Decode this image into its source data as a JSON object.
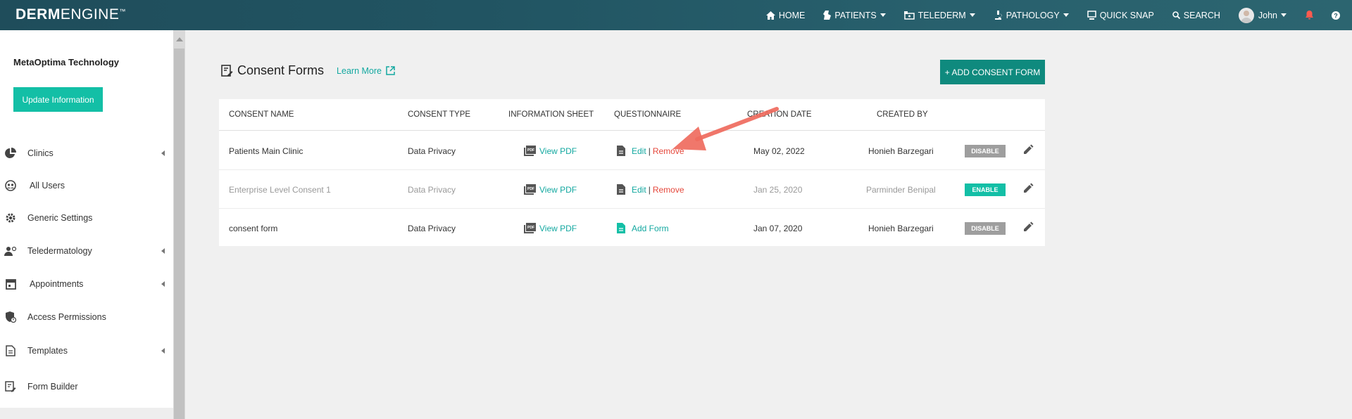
{
  "header": {
    "logo_bold": "DERM",
    "logo_light": "ENGINE",
    "logo_tm": "™",
    "nav": {
      "home": "HOME",
      "patients": "PATIENTS",
      "telederm": "TELEDERM",
      "pathology": "PATHOLOGY",
      "quick_snap": "QUICK SNAP",
      "search": "SEARCH",
      "user": "John"
    }
  },
  "sidebar": {
    "org_name": "MetaOptima Technology",
    "update_button": "Update Information",
    "items": [
      {
        "label": "Clinics",
        "icon": "pie-chart-icon"
      },
      {
        "label": "All Users",
        "icon": "users-globe-icon"
      },
      {
        "label": "Generic Settings",
        "icon": "gear-icon"
      },
      {
        "label": "Teledermatology",
        "icon": "user-settings-icon"
      },
      {
        "label": "Appointments",
        "icon": "calendar-icon"
      },
      {
        "label": "Access Permissions",
        "icon": "shield-icon"
      },
      {
        "label": "Templates",
        "icon": "document-icon"
      },
      {
        "label": "Form Builder",
        "icon": "form-edit-icon"
      }
    ]
  },
  "main": {
    "title": "Consent Forms",
    "learn_more": "Learn More",
    "add_button": "+ ADD CONSENT FORM",
    "columns": {
      "consent_name": "CONSENT NAME",
      "consent_type": "CONSENT TYPE",
      "information_sheet": "INFORMATION SHEET",
      "questionnaire": "QUESTIONNAIRE",
      "creation_date": "CREATION DATE",
      "created_by": "CREATED BY"
    },
    "rows": [
      {
        "name": "Patients Main Clinic",
        "type": "Data Privacy",
        "sheet": "View PDF",
        "edit": "Edit",
        "sep": "|",
        "remove": "Remove",
        "date": "May 02, 2022",
        "by": "Honieh Barzegari",
        "status": "DISABLE"
      },
      {
        "name": "Enterprise Level Consent 1",
        "type": "Data Privacy",
        "sheet": "View PDF",
        "edit": "Edit",
        "sep": "|",
        "remove": "Remove",
        "date": "Jan 25, 2020",
        "by": "Parminder Benipal",
        "status": "ENABLE"
      },
      {
        "name": "consent form",
        "type": "Data Privacy",
        "sheet": "View PDF",
        "add_form": "Add Form",
        "date": "Jan 07, 2020",
        "by": "Honieh Barzegari",
        "status": "DISABLE"
      }
    ]
  },
  "colors": {
    "accent": "#13bfa6",
    "add_button": "#0f8a7e",
    "remove": "#e5483c",
    "annotation_arrow": "#ef6b5e"
  }
}
